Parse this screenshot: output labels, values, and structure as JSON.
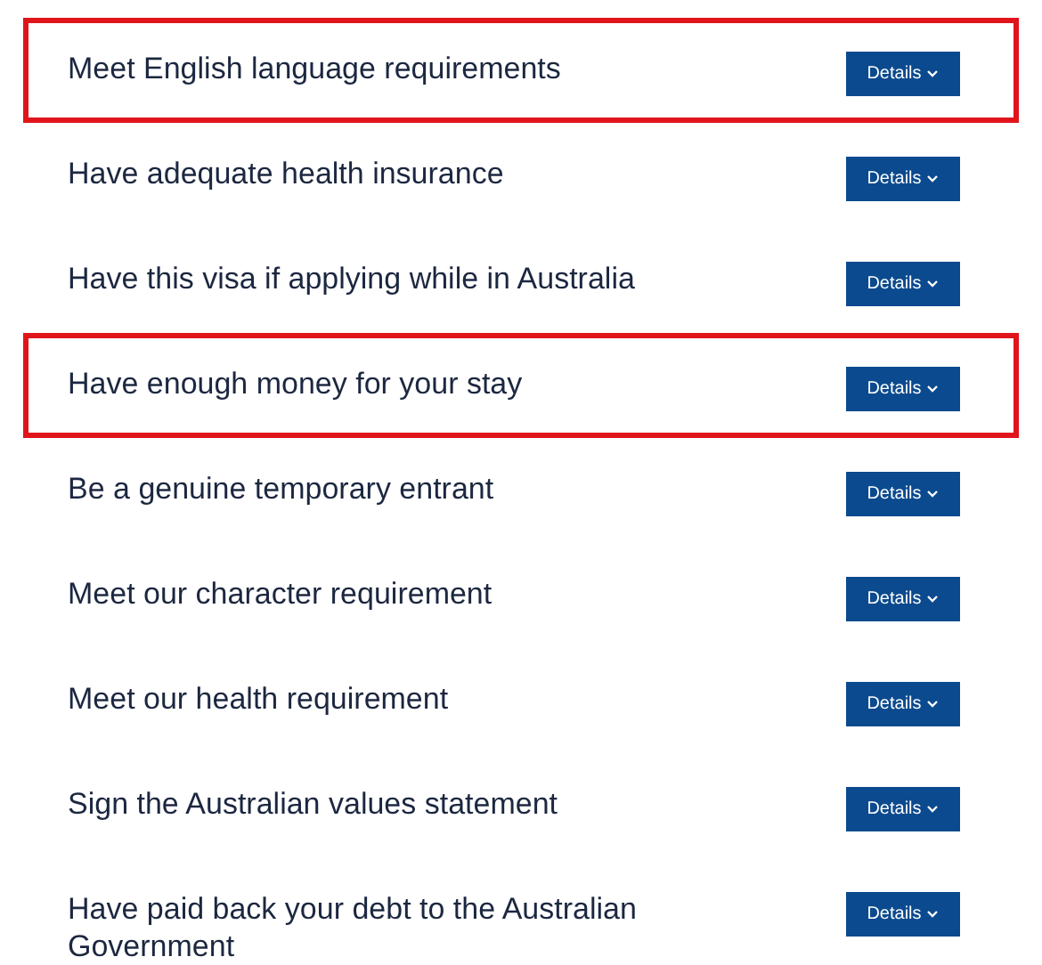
{
  "requirements": [
    {
      "title": "Meet English language requirements",
      "button": "Details",
      "highlighted": true
    },
    {
      "title": "Have adequate health insurance",
      "button": "Details",
      "highlighted": false
    },
    {
      "title": "Have this visa if applying while in Australia",
      "button": "Details",
      "highlighted": false
    },
    {
      "title": "Have enough money for your stay",
      "button": "Details",
      "highlighted": true
    },
    {
      "title": "Be a genuine temporary entrant",
      "button": "Details",
      "highlighted": false
    },
    {
      "title": "Meet our character requirement",
      "button": "Details",
      "highlighted": false
    },
    {
      "title": "Meet our health requirement",
      "button": "Details",
      "highlighted": false
    },
    {
      "title": "Sign the Australian values statement",
      "button": "Details",
      "highlighted": false
    },
    {
      "title": "Have paid back your debt to the Australian Government",
      "button": "Details",
      "highlighted": false
    }
  ]
}
